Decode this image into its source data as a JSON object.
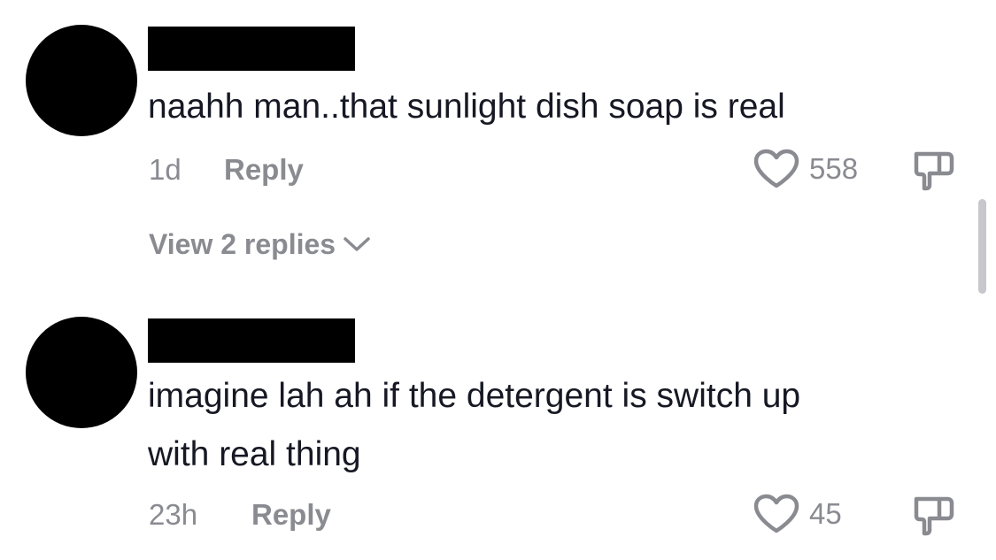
{
  "colors": {
    "text_primary": "#161823",
    "text_secondary": "#8a8b91",
    "avatar": "#000000",
    "redaction": "#000000",
    "scrollbar": "#c8c8cc"
  },
  "comments": [
    {
      "avatar_icon": "avatar-redacted",
      "username_redacted": true,
      "text": "naahh man..that sunlight dish soap is real",
      "time": "1d",
      "reply_label": "Reply",
      "like_icon": "heart-outline-icon",
      "like_count": "558",
      "dislike_icon": "thumbs-down-icon",
      "view_replies_label": "View 2 replies",
      "view_replies_icon": "chevron-down-icon"
    },
    {
      "avatar_icon": "avatar-redacted",
      "username_redacted": true,
      "text": "imagine lah ah if the detergent is switch up\nwith real thing",
      "time": "23h",
      "reply_label": "Reply",
      "like_icon": "heart-outline-icon",
      "like_count": "45",
      "dislike_icon": "thumbs-down-icon"
    }
  ]
}
